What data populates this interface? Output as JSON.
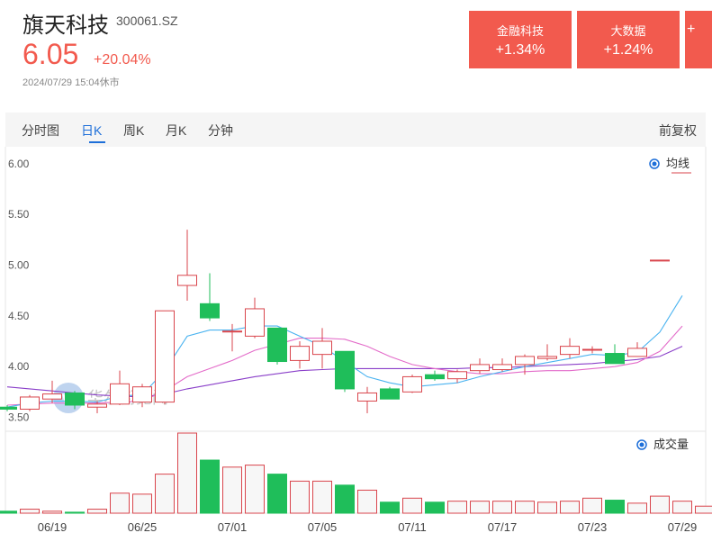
{
  "stock": {
    "name": "旗天科技",
    "code": "300061.SZ",
    "price": "6.05",
    "change_pct": "+20.04%",
    "time": "2024/07/29 15:04休市"
  },
  "sectors": [
    {
      "name": "金融科技",
      "change": "+1.34%"
    },
    {
      "name": "大数据",
      "change": "+1.24%"
    },
    {
      "name": "",
      "change": "+"
    }
  ],
  "tabs": [
    {
      "label": "分时图",
      "active": false
    },
    {
      "label": "日K",
      "active": true
    },
    {
      "label": "周K",
      "active": false
    },
    {
      "label": "月K",
      "active": false
    },
    {
      "label": "分钟",
      "active": false
    }
  ],
  "restore_label": "前复权",
  "colors": {
    "up": "#d9454c",
    "down": "#1fbe5a",
    "accent": "#1e6fd9",
    "ma5": "#4ab3f0",
    "ma10": "#e36bc9",
    "ma20": "#8a3fc9"
  },
  "watermark": "华尔街见闻",
  "chart_data": {
    "type": "candlestick",
    "price_yticks": [
      "6.00",
      "5.50",
      "5.00",
      "4.50",
      "4.00",
      "3.50"
    ],
    "ylim": [
      3.38,
      6.15
    ],
    "legend_price": "均线",
    "legend_volume": "成交量",
    "x_ticks": [
      "06/19",
      "06/25",
      "07/01",
      "07/05",
      "07/11",
      "07/17",
      "07/23",
      "07/29"
    ],
    "dates": [
      "06/17",
      "06/18",
      "06/19",
      "06/20",
      "06/21",
      "06/24",
      "06/25",
      "06/26",
      "06/27",
      "06/28",
      "07/01",
      "07/02",
      "07/03",
      "07/04",
      "07/05",
      "07/08",
      "07/09",
      "07/10",
      "07/11",
      "07/12",
      "07/15",
      "07/16",
      "07/17",
      "07/18",
      "07/19",
      "07/22",
      "07/23",
      "07/24",
      "07/25",
      "07/26",
      "07/29"
    ],
    "ohlc": [
      [
        3.6,
        3.62,
        3.56,
        3.58
      ],
      [
        3.58,
        3.72,
        3.56,
        3.7
      ],
      [
        3.68,
        3.86,
        3.64,
        3.73
      ],
      [
        3.74,
        3.76,
        3.58,
        3.62
      ],
      [
        3.6,
        3.66,
        3.54,
        3.63
      ],
      [
        3.63,
        3.96,
        3.62,
        3.83
      ],
      [
        3.65,
        3.83,
        3.6,
        3.8
      ],
      [
        3.65,
        4.55,
        3.63,
        4.55
      ],
      [
        4.8,
        5.35,
        4.65,
        4.9
      ],
      [
        4.62,
        4.92,
        4.45,
        4.48
      ],
      [
        4.35,
        4.42,
        4.15,
        4.35
      ],
      [
        4.3,
        4.68,
        4.28,
        4.57
      ],
      [
        4.38,
        4.38,
        4.02,
        4.05
      ],
      [
        4.06,
        4.25,
        3.98,
        4.2
      ],
      [
        4.12,
        4.38,
        3.98,
        4.25
      ],
      [
        4.15,
        4.15,
        3.75,
        3.78
      ],
      [
        3.66,
        3.8,
        3.54,
        3.74
      ],
      [
        3.78,
        3.8,
        3.68,
        3.68
      ],
      [
        3.75,
        3.92,
        3.74,
        3.9
      ],
      [
        3.92,
        3.96,
        3.86,
        3.88
      ],
      [
        3.88,
        3.97,
        3.84,
        3.95
      ],
      [
        3.96,
        4.08,
        3.93,
        4.02
      ],
      [
        3.97,
        4.08,
        3.95,
        4.02
      ],
      [
        4.02,
        4.12,
        3.92,
        4.1
      ],
      [
        4.08,
        4.22,
        4.06,
        4.1
      ],
      [
        4.12,
        4.28,
        4.08,
        4.2
      ],
      [
        4.17,
        4.2,
        4.13,
        4.17
      ],
      [
        4.13,
        4.22,
        4.08,
        4.03
      ],
      [
        4.1,
        4.24,
        4.1,
        4.18
      ],
      [
        5.05,
        5.05,
        5.05,
        5.05
      ]
    ],
    "ma5": [
      3.6,
      3.64,
      3.66,
      3.66,
      3.65,
      3.71,
      3.72,
      3.96,
      4.3,
      4.36,
      4.36,
      4.4,
      4.4,
      4.3,
      4.2,
      4.05,
      3.9,
      3.84,
      3.8,
      3.82,
      3.84,
      3.9,
      3.95,
      4.0,
      4.04,
      4.08,
      4.12,
      4.11,
      4.14,
      4.34,
      4.7
    ],
    "ma10": [
      3.62,
      3.63,
      3.64,
      3.64,
      3.64,
      3.65,
      3.66,
      3.76,
      3.9,
      3.98,
      4.06,
      4.16,
      4.22,
      4.28,
      4.28,
      4.27,
      4.2,
      4.1,
      4.02,
      3.98,
      3.95,
      3.93,
      3.93,
      3.95,
      3.96,
      3.96,
      3.98,
      4.0,
      4.04,
      4.15,
      4.4
    ],
    "ma20": [
      3.8,
      3.78,
      3.76,
      3.74,
      3.72,
      3.71,
      3.7,
      3.73,
      3.78,
      3.82,
      3.86,
      3.9,
      3.93,
      3.96,
      3.97,
      3.98,
      3.98,
      3.98,
      3.98,
      3.98,
      3.98,
      3.99,
      3.99,
      4.0,
      4.01,
      4.02,
      4.03,
      4.05,
      4.07,
      4.1,
      4.2
    ],
    "volume": [
      2,
      4,
      2,
      1,
      4,
      20,
      19,
      39,
      80,
      53,
      46,
      48,
      39,
      32,
      32,
      28,
      23,
      11,
      15,
      11,
      12,
      12,
      12,
      12,
      11,
      12,
      15,
      13,
      10,
      17,
      12,
      7
    ]
  }
}
